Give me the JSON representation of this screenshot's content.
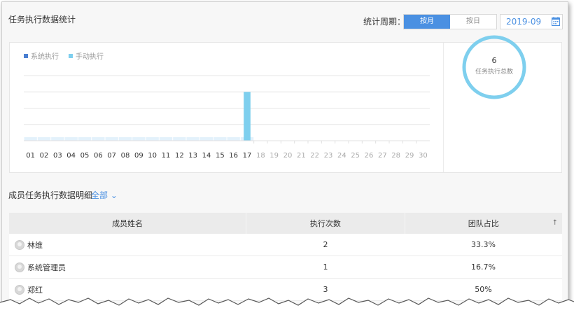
{
  "header": {
    "title": "任务执行数据统计",
    "period_label": "统计周期：",
    "period_options": [
      {
        "label": "按月",
        "active": true
      },
      {
        "label": "按日",
        "active": false
      }
    ],
    "date_value": "2019-09",
    "calendar_icon": "calendar-icon"
  },
  "chart_data": {
    "type": "bar",
    "stacked": true,
    "categories": [
      "01",
      "02",
      "03",
      "04",
      "05",
      "06",
      "07",
      "08",
      "09",
      "10",
      "11",
      "12",
      "13",
      "14",
      "15",
      "16",
      "17",
      "18",
      "19",
      "20",
      "21",
      "22",
      "23",
      "24",
      "25",
      "26",
      "27",
      "28",
      "29",
      "30"
    ],
    "series": [
      {
        "name": "系统执行",
        "color": "#4a7fd1",
        "values": [
          0,
          0,
          0,
          0,
          0,
          0,
          0,
          0,
          0,
          0,
          0,
          0,
          0,
          0,
          0,
          0,
          0,
          0,
          0,
          0,
          0,
          0,
          0,
          0,
          0,
          0,
          0,
          0,
          0,
          0
        ]
      },
      {
        "name": "手动执行",
        "color": "#7ecfee",
        "values": [
          0,
          0,
          0,
          0,
          0,
          0,
          0,
          0,
          0,
          0,
          0,
          0,
          0,
          0,
          0,
          0,
          6,
          0,
          0,
          0,
          0,
          0,
          0,
          0,
          0,
          0,
          0,
          0,
          0,
          0
        ]
      }
    ],
    "ylim": [
      0,
      8
    ],
    "grid": true,
    "legend_position": "top-left",
    "active_range_end": "17",
    "placeholder_color": "#e3f1fb"
  },
  "summary": {
    "total": "6",
    "total_label": "任务执行总数",
    "ring_color": "#7ecfee"
  },
  "members": {
    "title": "成员任务执行数据明细",
    "filter_label": "全部 ⌄",
    "columns": [
      "成员姓名",
      "执行次数",
      "团队占比"
    ],
    "sort_icon": "↑",
    "rows": [
      {
        "name": "林维",
        "count": "2",
        "ratio": "33.3%"
      },
      {
        "name": "系统管理员",
        "count": "1",
        "ratio": "16.7%"
      },
      {
        "name": "郑红",
        "count": "3",
        "ratio": "50%"
      }
    ]
  }
}
